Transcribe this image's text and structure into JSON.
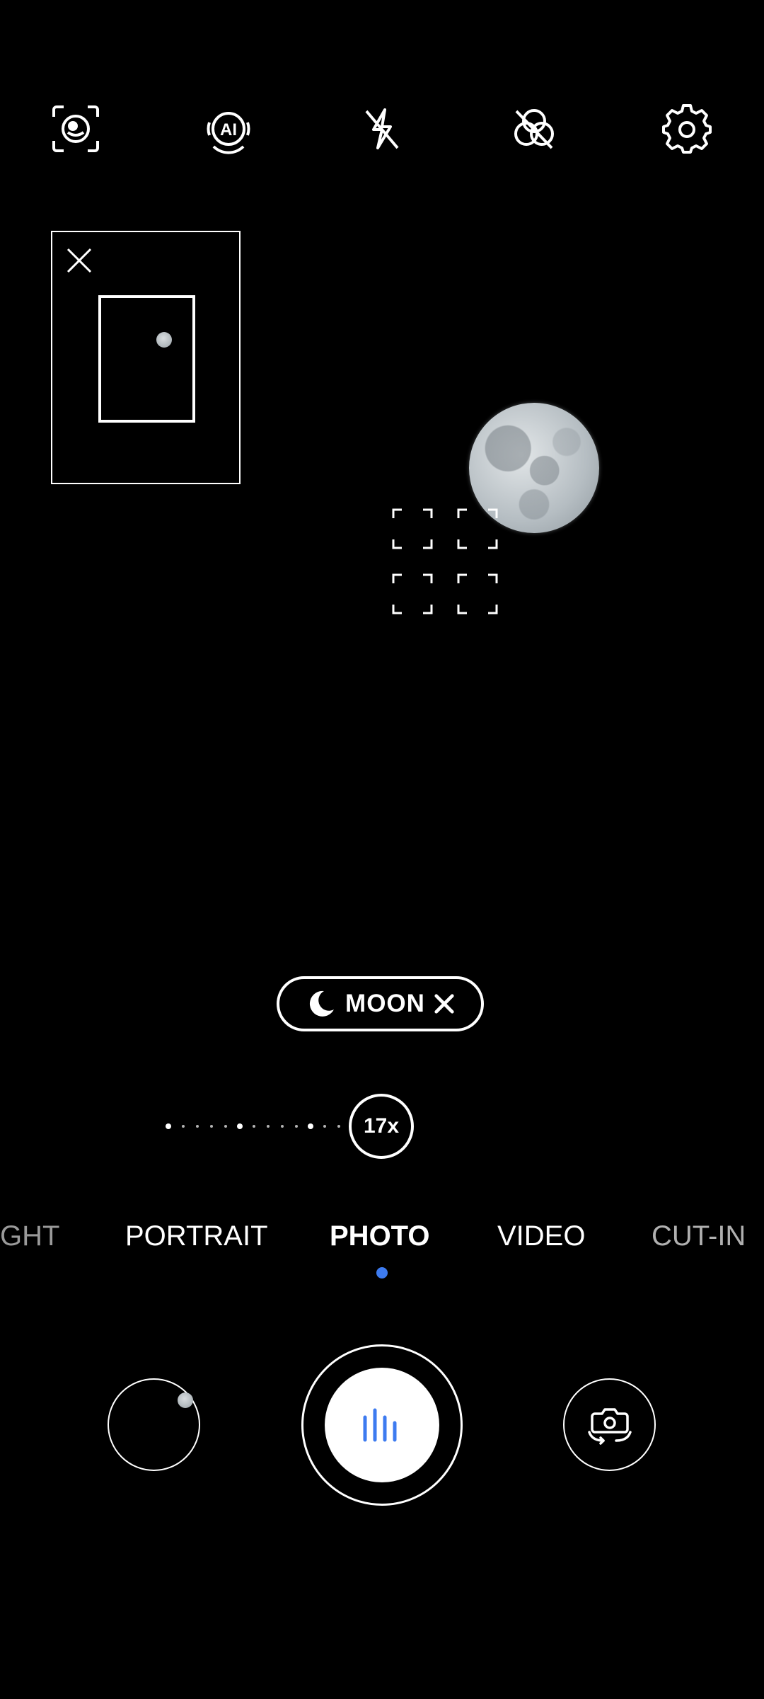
{
  "top_bar": {
    "icons": [
      "face-scan-icon",
      "ai-icon",
      "flash-off-icon",
      "filter-off-icon",
      "settings-gear-icon"
    ]
  },
  "minimap": {
    "close_icon": "close-icon"
  },
  "scene_badge": {
    "label": "MOON",
    "icon": "crescent-moon-icon",
    "close_icon": "close-x-icon"
  },
  "zoom": {
    "value_label": "17x"
  },
  "modes": {
    "items": [
      "GHT",
      "PORTRAIT",
      "PHOTO",
      "VIDEO",
      "CUT-IN"
    ],
    "active": "PHOTO"
  },
  "controls": {
    "gallery_icon": "gallery-thumbnail",
    "shutter_icon": "shutter-bars-icon",
    "switch_icon": "switch-camera-icon"
  },
  "colors": {
    "accent": "#3d7bf0",
    "background": "#000000",
    "foreground": "#ffffff"
  }
}
